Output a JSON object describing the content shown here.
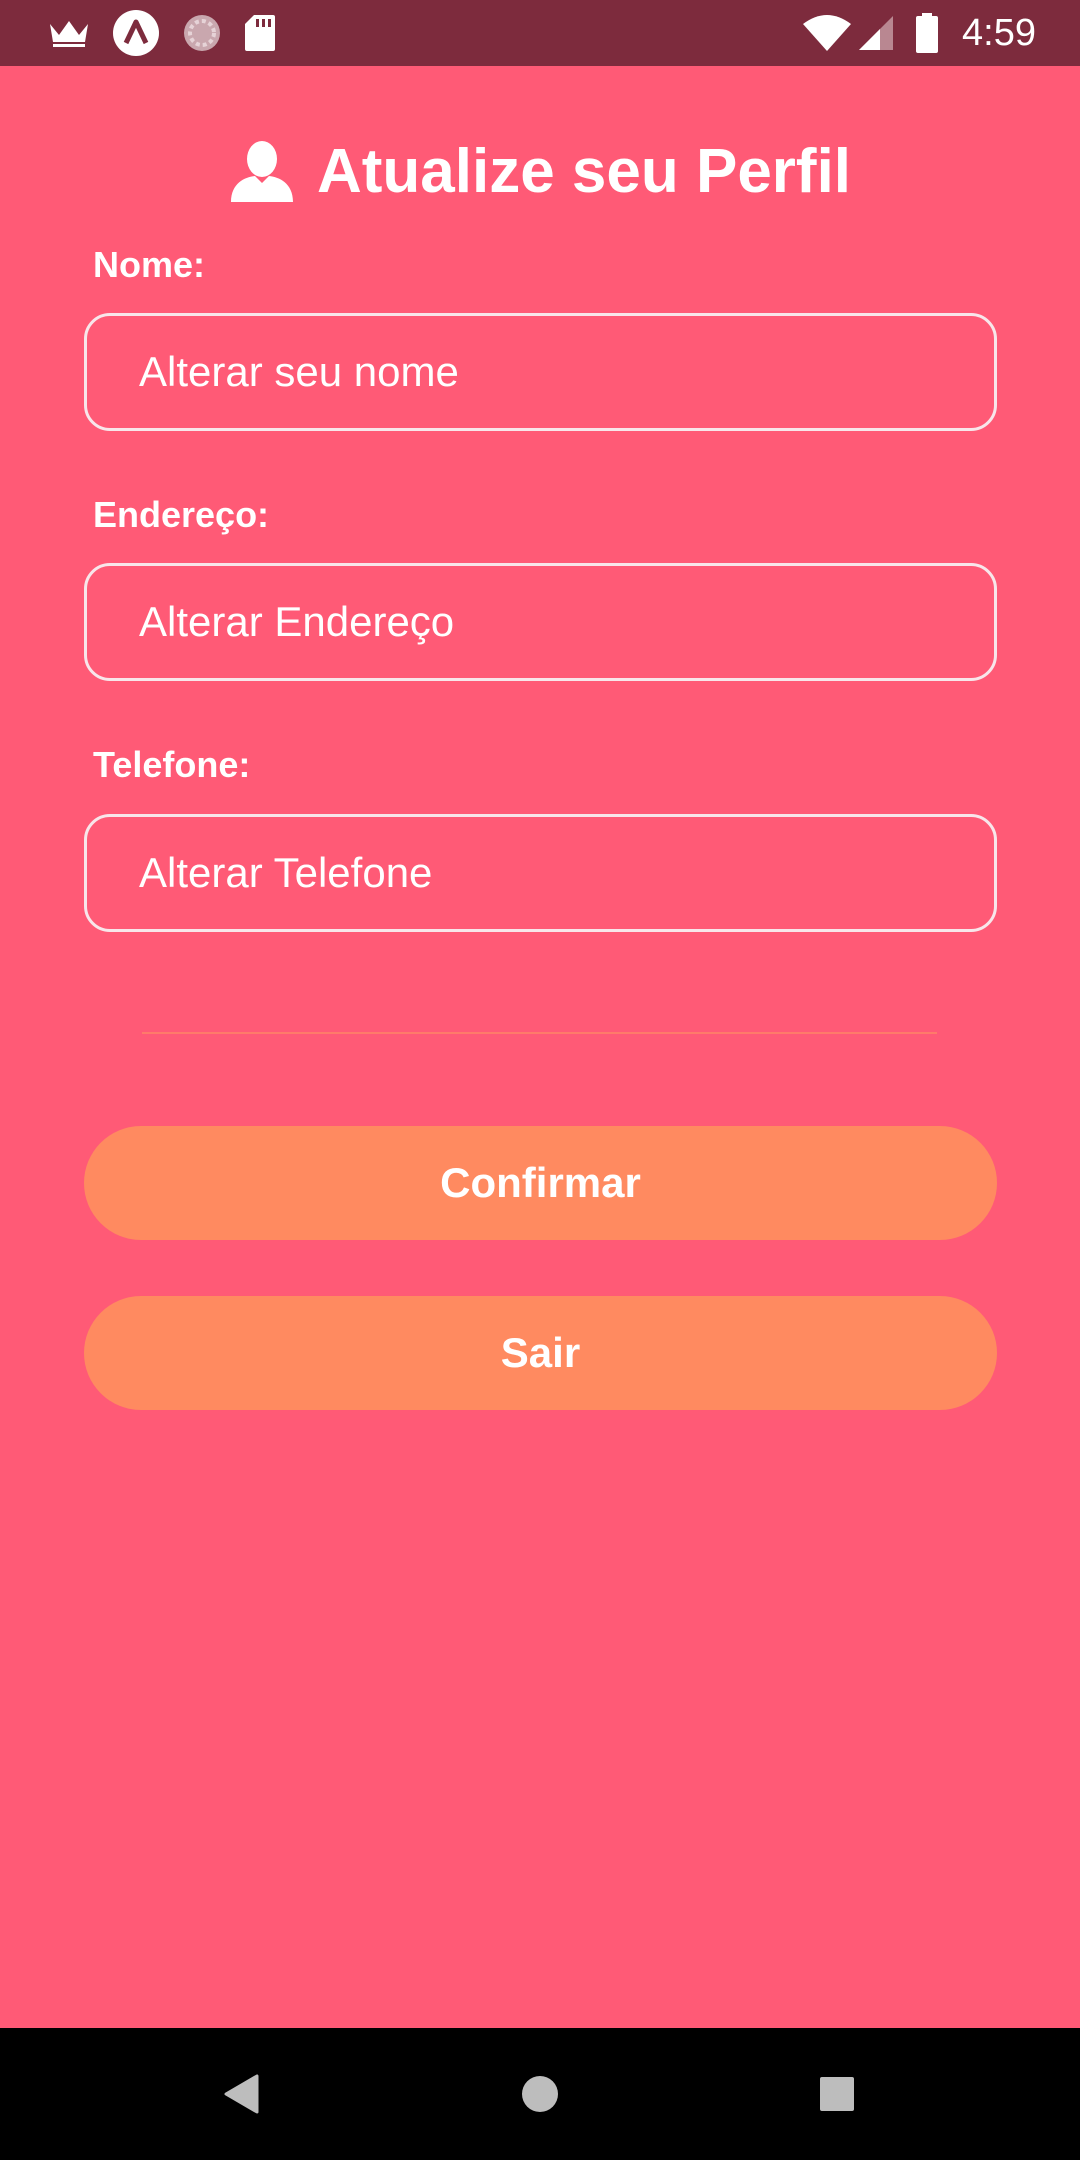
{
  "colors": {
    "status_bar": "#7d2b3d",
    "background": "#ff5a76",
    "input_border": "#f8e6ea",
    "button": "#ff8a60",
    "divider": "#ff7a6a",
    "nav_bar": "#000000"
  },
  "status_bar": {
    "time": "4:59",
    "left_icons": [
      "crown-icon",
      "app-logo-icon",
      "sync-icon",
      "sd-card-icon"
    ],
    "right_icons": [
      "wifi-icon",
      "cell-signal-icon",
      "battery-icon"
    ]
  },
  "header": {
    "icon": "user-icon",
    "title": "Atualize seu Perfil"
  },
  "form": {
    "name": {
      "label": "Nome:",
      "placeholder": "Alterar seu nome",
      "value": ""
    },
    "address": {
      "label": "Endereço:",
      "placeholder": "Alterar Endereço",
      "value": ""
    },
    "phone": {
      "label": "Telefone:",
      "placeholder": "Alterar Telefone",
      "value": ""
    }
  },
  "buttons": {
    "confirm_label": "Confirmar",
    "exit_label": "Sair"
  },
  "nav_bar": {
    "icons": [
      "back-icon",
      "home-icon",
      "recents-icon"
    ]
  }
}
